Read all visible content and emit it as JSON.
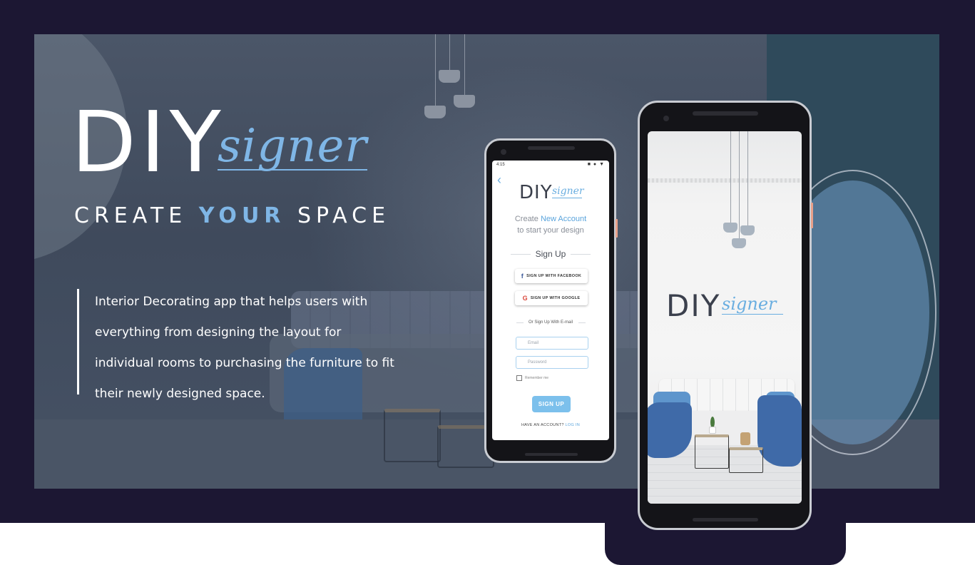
{
  "brand": {
    "diy": "DIY",
    "signer": "signer",
    "tagline_pre": "CREATE",
    "tagline_accent": "YOUR",
    "tagline_post": "SPACE"
  },
  "description": "Interior Decorating app that helps users with everything from designing the layout for individual rooms to purchasing the furniture to fit their newly designed space.",
  "phone_small": {
    "status_time": "4:15",
    "status_icons": "■ ● ▼",
    "back_icon": "chevron-left-icon",
    "logo_diy": "DIY",
    "logo_signer": "signer",
    "create_prefix": "Create",
    "create_accent": "New Account",
    "create_sub": "to start your design",
    "signup_heading": "Sign Up",
    "facebook_icon": "f",
    "facebook_label": "SIGN UP WITH FACEBOOK",
    "google_icon": "G",
    "google_label": "SIGN UP WITH GOOGLE",
    "or_email": "Or Sign Up With E-mail",
    "email_placeholder": "Email",
    "password_placeholder": "Password",
    "remember_label": "Remember me",
    "submit_label": "SIGN UP",
    "have_account": "HAVE AN ACCOUNT?",
    "login_link": "LOG IN"
  },
  "phone_big": {
    "logo_diy": "DIY",
    "logo_signer": "signer"
  },
  "colors": {
    "frame": "#1c1733",
    "accent_blue": "#7fb6e6",
    "button_blue": "#7cc0ec"
  }
}
